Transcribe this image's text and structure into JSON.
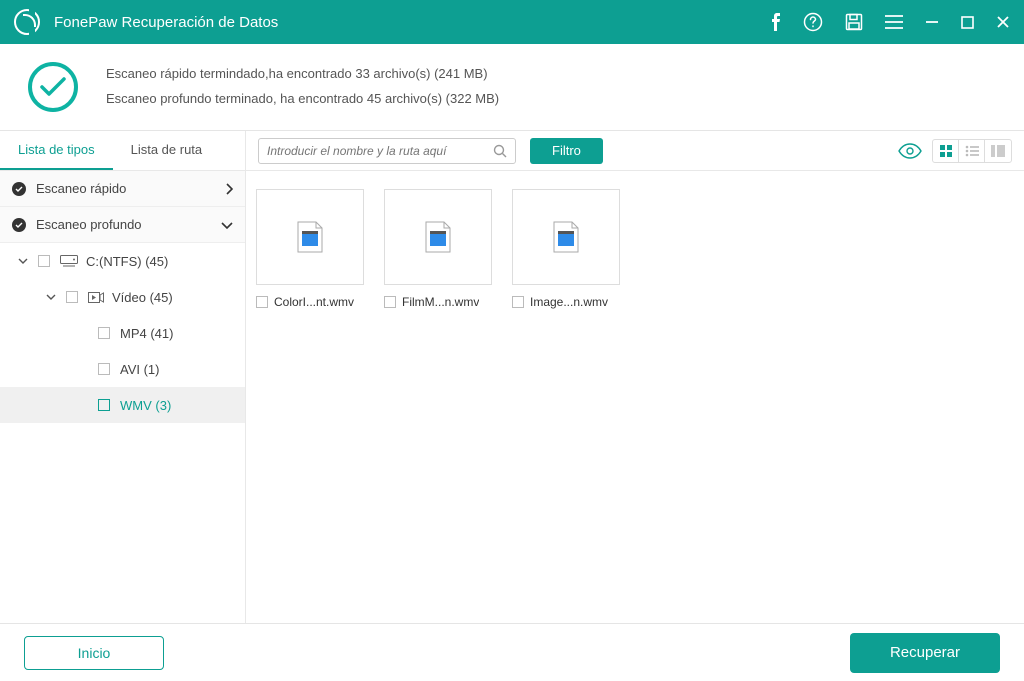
{
  "titlebar": {
    "title": "FonePaw Recuperación de Datos"
  },
  "status": {
    "line1": "Escaneo rápido termindado,ha encontrado 33 archivo(s) (241 MB)",
    "line2": "Escaneo profundo terminado, ha encontrado 45 archivo(s) (322 MB)"
  },
  "tabs": {
    "types": "Lista de tipos",
    "path": "Lista de ruta"
  },
  "tree": {
    "quick": "Escaneo rápido",
    "deep": "Escaneo profundo",
    "drive": "C:(NTFS) (45)",
    "video": "Vídeo (45)",
    "mp4": "MP4 (41)",
    "avi": "AVI (1)",
    "wmv": "WMV (3)"
  },
  "toolbar": {
    "searchPlaceholder": "Introducir el nombre y la ruta aquí",
    "filter": "Filtro"
  },
  "files": [
    {
      "name": "ColorI...nt.wmv"
    },
    {
      "name": "FilmM...n.wmv"
    },
    {
      "name": "Image...n.wmv"
    }
  ],
  "footer": {
    "home": "Inicio",
    "recover": "Recuperar"
  }
}
